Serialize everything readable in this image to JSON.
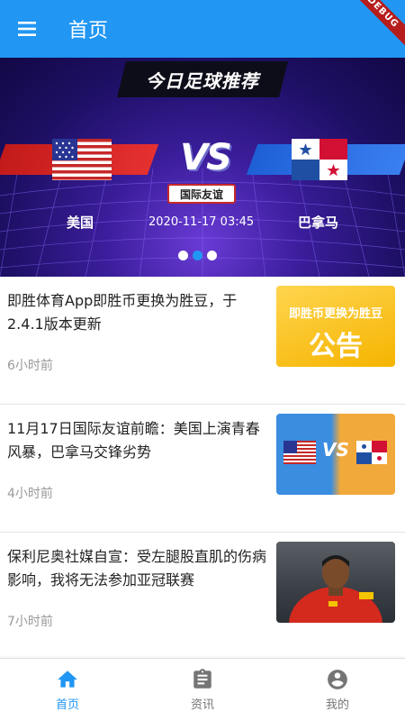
{
  "appbar": {
    "title": "首页",
    "debug_label": "DEBUG",
    "color": "#2196f3"
  },
  "banner": {
    "heading": "今日足球推荐",
    "team_home": "美国",
    "team_away": "巴拿马",
    "vs": "VS",
    "match_type": "国际友谊",
    "match_time": "2020-11-17 03:45",
    "page_count": 3,
    "active_page": 1
  },
  "news": [
    {
      "title": "即胜体育App即胜币更换为胜豆，于2.4.1版本更新",
      "time": "6小时前",
      "thumb_top": "即胜币更换为胜豆",
      "thumb_big": "公告"
    },
    {
      "title": "11月17日国际友谊前瞻：美国上演青春风暴，巴拿马交锋劣势",
      "time": "4小时前",
      "thumb_vs": "VS"
    },
    {
      "title": "保利尼奥社媒自宣：受左腿股直肌的伤病影响，我将无法参加亚冠联赛",
      "time": "7小时前"
    }
  ],
  "bottom_nav": [
    {
      "label": "首页",
      "icon": "home-icon",
      "active": true
    },
    {
      "label": "资讯",
      "icon": "clipboard-icon",
      "active": false
    },
    {
      "label": "我的",
      "icon": "account-icon",
      "active": false
    }
  ],
  "colors": {
    "accent": "#2196f3",
    "inactive": "#757575",
    "time_text": "#999999"
  }
}
